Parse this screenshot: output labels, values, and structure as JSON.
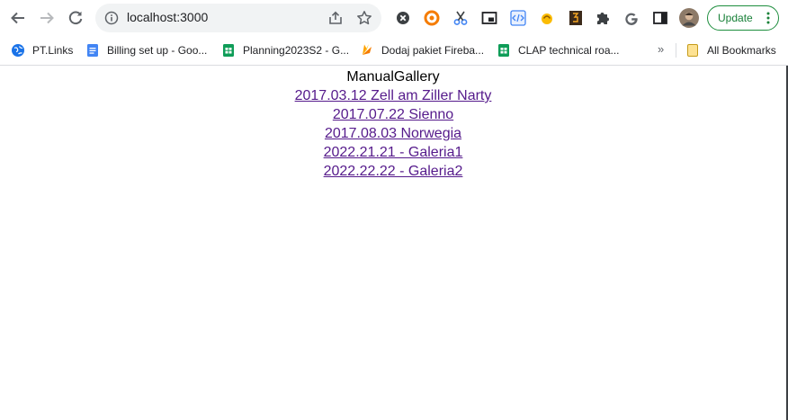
{
  "browser": {
    "url": "localhost:3000",
    "update_label": "Update"
  },
  "bookmarks": [
    {
      "label": "PT.Links",
      "icon": "globe-icon"
    },
    {
      "label": "Billing set up - Goo...",
      "icon": "google-docs-icon"
    },
    {
      "label": "Planning2023S2 - G...",
      "icon": "google-sheets-icon"
    },
    {
      "label": "Dodaj pakiet Fireba...",
      "icon": "firebase-icon"
    },
    {
      "label": "CLAP technical roa...",
      "icon": "google-sheets-icon"
    }
  ],
  "bookmarks_overflow": "»",
  "all_bookmarks_label": "All Bookmarks",
  "page": {
    "title": "ManualGallery",
    "links": [
      "2017.03.12 Zell am Ziller Narty",
      "2017.07.22 Sienno",
      "2017.08.03 Norwegia",
      "2022.21.21 - Galeria1",
      "2022.22.22 - Galeria2"
    ]
  },
  "colors": {
    "link": "#551a8b",
    "update_accent": "#188038"
  }
}
